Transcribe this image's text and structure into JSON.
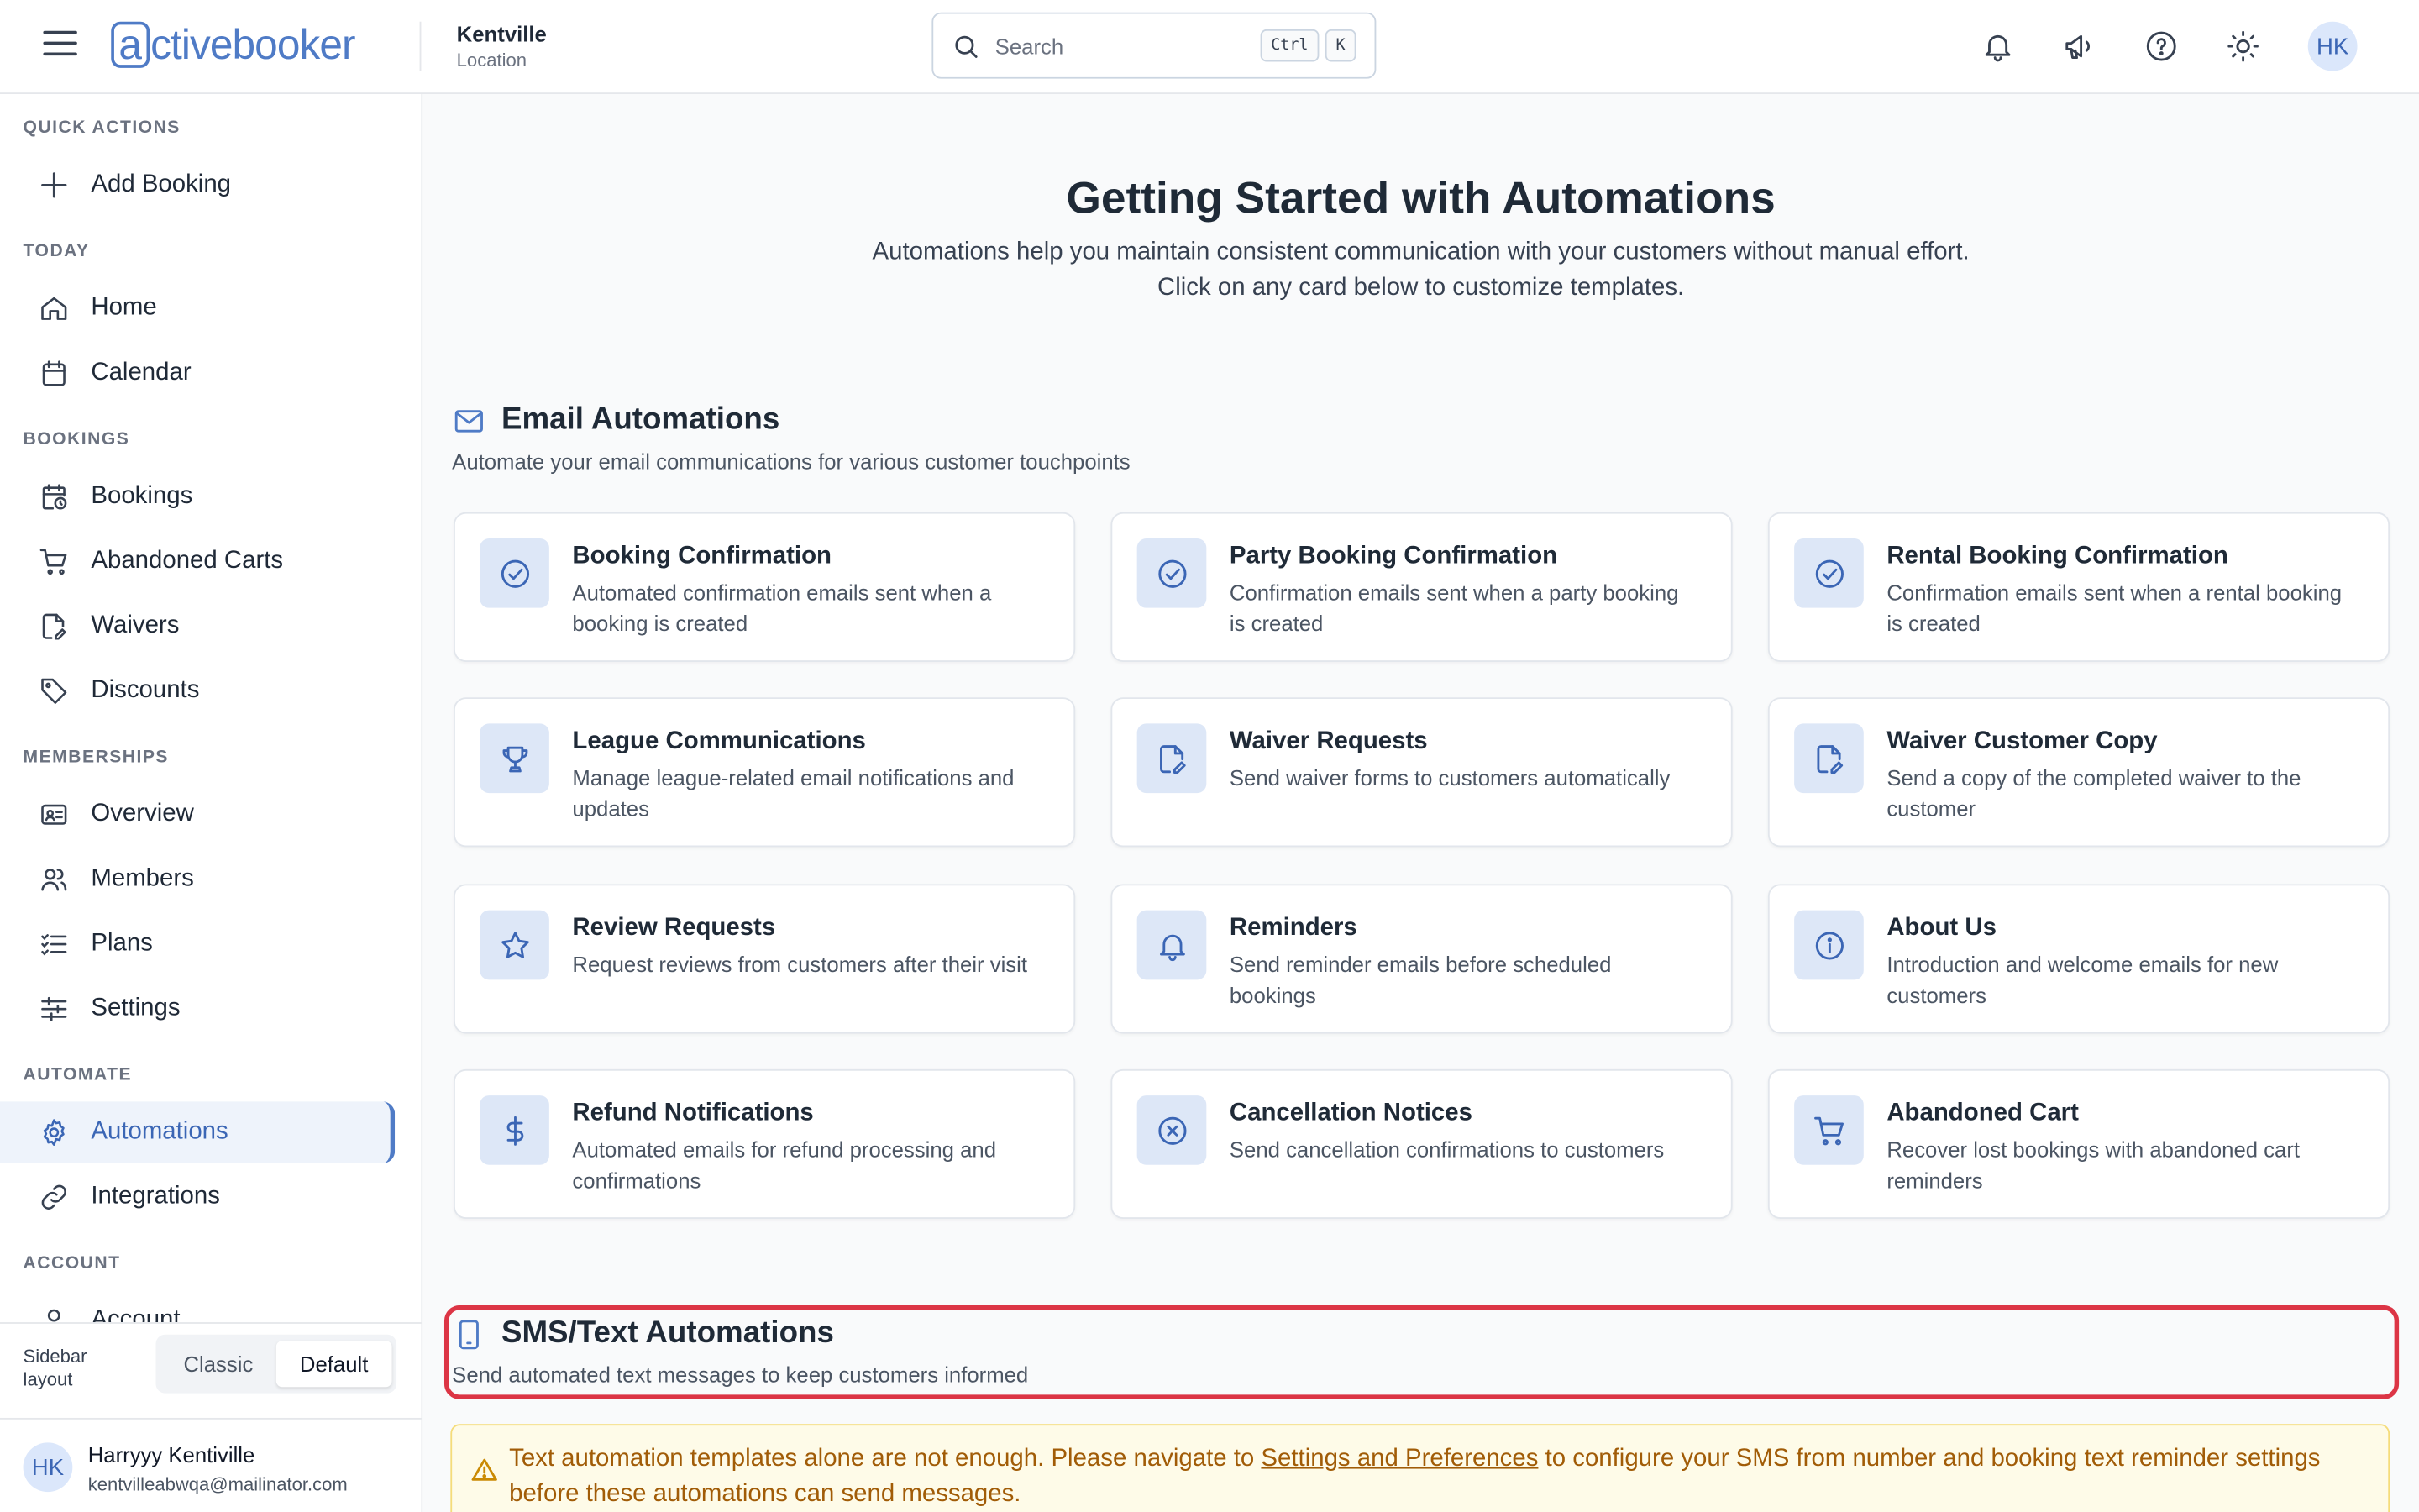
{
  "app": {
    "logo_text_a": "a",
    "logo_text_rest": "ctivebooker",
    "location_name": "Kentville",
    "location_label": "Location"
  },
  "search": {
    "placeholder": "Search",
    "key1": "Ctrl",
    "key2": "K"
  },
  "header": {
    "avatar_initials": "HK"
  },
  "sidebar": {
    "quick_actions_label": "QUICK ACTIONS",
    "add_booking": "Add Booking",
    "today_label": "TODAY",
    "home": "Home",
    "calendar": "Calendar",
    "bookings_label": "BOOKINGS",
    "bookings": "Bookings",
    "abandoned_carts": "Abandoned Carts",
    "waivers": "Waivers",
    "discounts": "Discounts",
    "memberships_label": "MEMBERSHIPS",
    "overview": "Overview",
    "members": "Members",
    "plans": "Plans",
    "settings": "Settings",
    "automate_label": "AUTOMATE",
    "automations": "Automations",
    "integrations": "Integrations",
    "account_label": "ACCOUNT",
    "account": "Account",
    "layout_label": "Sidebar layout",
    "layout_classic": "Classic",
    "layout_default": "Default",
    "user_initials": "HK",
    "user_name": "Harryyy Kentiville",
    "user_email": "kentvilleabwqa@mailinator.com"
  },
  "main": {
    "title": "Getting Started with Automations",
    "subtitle_line1": "Automations help you maintain consistent communication with your customers without manual effort.",
    "subtitle_line2": "Click on any card below to customize templates.",
    "email_section_title": "Email Automations",
    "email_section_desc": "Automate your email communications for various customer touchpoints",
    "cards": [
      {
        "title": "Booking Confirmation",
        "desc": "Automated confirmation emails sent when a booking is created",
        "icon": "check-circle-icon"
      },
      {
        "title": "Party Booking Confirmation",
        "desc": "Confirmation emails sent when a party booking is created",
        "icon": "check-circle-icon"
      },
      {
        "title": "Rental Booking Confirmation",
        "desc": "Confirmation emails sent when a rental booking is created",
        "icon": "check-circle-icon"
      },
      {
        "title": "League Communications",
        "desc": "Manage league-related email notifications and updates",
        "icon": "trophy-icon"
      },
      {
        "title": "Waiver Requests",
        "desc": "Send waiver forms to customers automatically",
        "icon": "file-signature-icon"
      },
      {
        "title": "Waiver Customer Copy",
        "desc": "Send a copy of the completed waiver to the customer",
        "icon": "file-signature-icon"
      },
      {
        "title": "Review Requests",
        "desc": "Request reviews from customers after their visit",
        "icon": "star-icon"
      },
      {
        "title": "Reminders",
        "desc": "Send reminder emails before scheduled bookings",
        "icon": "bell-icon"
      },
      {
        "title": "About Us",
        "desc": "Introduction and welcome emails for new customers",
        "icon": "info-icon"
      },
      {
        "title": "Refund Notifications",
        "desc": "Automated emails for refund processing and confirmations",
        "icon": "dollar-icon"
      },
      {
        "title": "Cancellation Notices",
        "desc": "Send cancellation confirmations to customers",
        "icon": "x-circle-icon"
      },
      {
        "title": "Abandoned Cart",
        "desc": "Recover lost bookings with abandoned cart reminders",
        "icon": "cart-icon"
      }
    ],
    "sms_section_title": "SMS/Text Automations",
    "sms_section_desc": "Send automated text messages to keep customers informed",
    "warning_before": "Text automation templates alone are not enough. Please navigate to ",
    "warning_link": "Settings and Preferences",
    "warning_after": " to configure your SMS from number and booking text reminder settings before these automations can send messages."
  },
  "colors": {
    "accent": "#4f7bc6",
    "highlight_border": "#dc3545",
    "warning_bg": "#fefbe8",
    "warning_text": "#a15c07"
  }
}
